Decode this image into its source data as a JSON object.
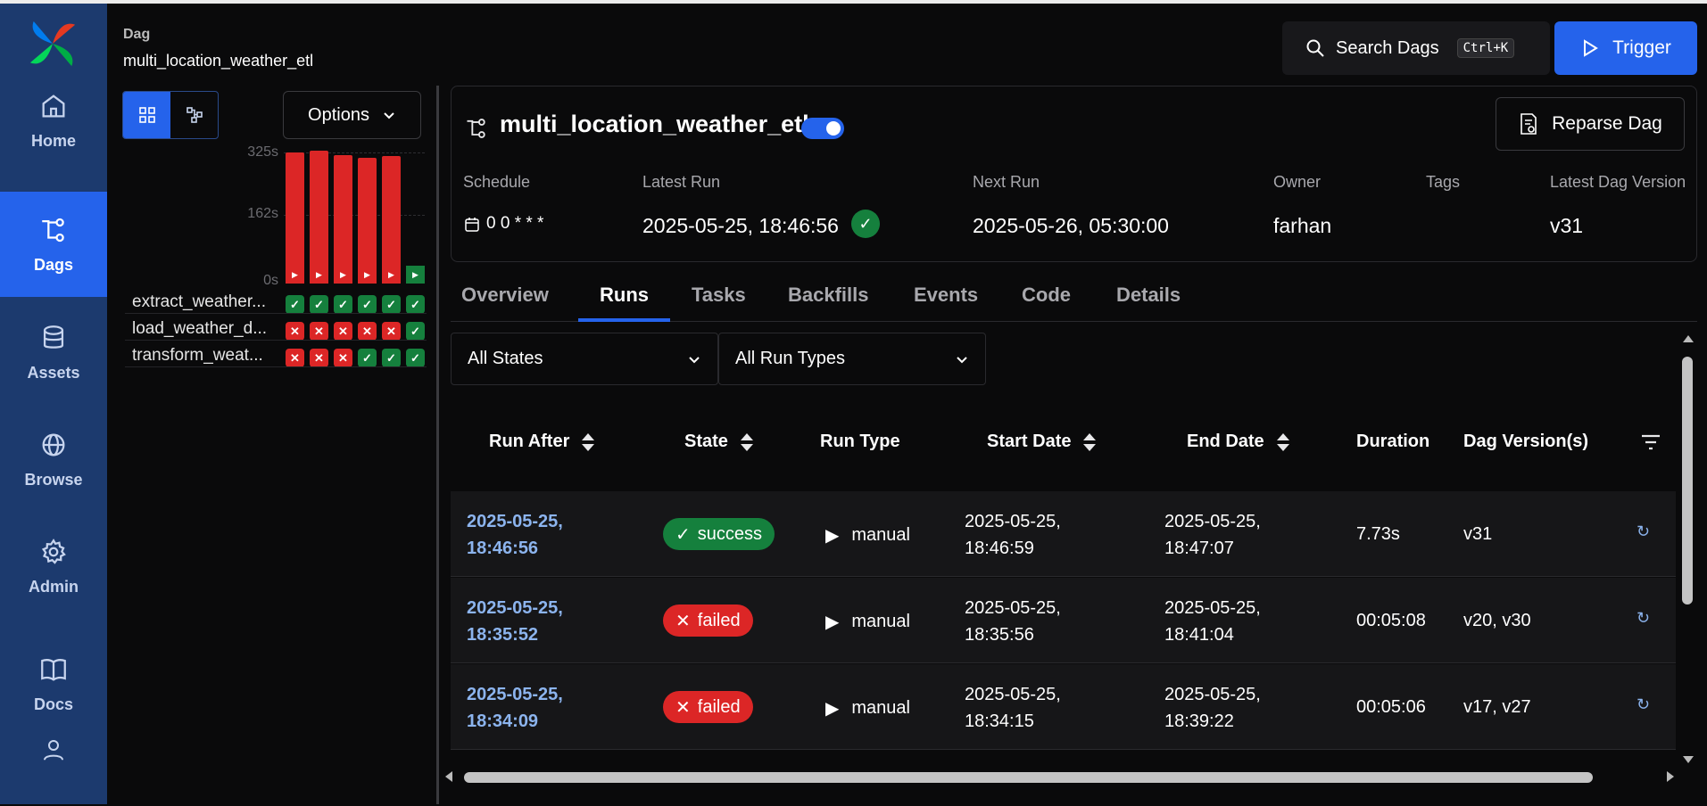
{
  "sidebar": {
    "items": [
      {
        "label": "Home",
        "icon": "home-icon"
      },
      {
        "label": "Dags",
        "icon": "dags-icon",
        "active": true
      },
      {
        "label": "Assets",
        "icon": "database-icon"
      },
      {
        "label": "Browse",
        "icon": "globe-icon"
      },
      {
        "label": "Admin",
        "icon": "gear-icon"
      },
      {
        "label": "Docs",
        "icon": "book-icon"
      },
      {
        "label": "",
        "icon": "user-icon"
      }
    ]
  },
  "breadcrumb": {
    "key": "Dag",
    "value": "multi_location_weather_etl"
  },
  "grid": {
    "options_label": "Options",
    "y_labels": [
      "325s",
      "162s",
      "0s"
    ],
    "run_bar_fraction": [
      0.98,
      0.99,
      0.96,
      0.94,
      0.95,
      0.07
    ],
    "run_bar_state": [
      "failed",
      "failed",
      "failed",
      "failed",
      "failed",
      "success"
    ],
    "tasks": [
      {
        "name": "extract_weather...",
        "states": [
          "ok",
          "ok",
          "ok",
          "ok",
          "ok",
          "ok"
        ]
      },
      {
        "name": "load_weather_d...",
        "states": [
          "x",
          "x",
          "x",
          "x",
          "x",
          "ok"
        ]
      },
      {
        "name": "transform_weat...",
        "states": [
          "x",
          "x",
          "x",
          "ok",
          "ok",
          "ok"
        ]
      }
    ]
  },
  "header": {
    "search_label": "Search Dags",
    "search_shortcut": "Ctrl+K",
    "trigger_label": "Trigger"
  },
  "dag": {
    "title": "multi_location_weather_etl",
    "paused": false,
    "reparse_label": "Reparse Dag",
    "meta_keys": {
      "schedule": "Schedule",
      "latest_run": "Latest Run",
      "next_run": "Next Run",
      "owner": "Owner",
      "tags": "Tags",
      "version": "Latest Dag Version"
    },
    "meta_values": {
      "schedule": "0 0 * * *",
      "latest_run": "2025-05-25, 18:46:56",
      "next_run": "2025-05-26, 05:30:00",
      "owner": "farhan",
      "tags": "",
      "version": "v31"
    }
  },
  "tabs": [
    "Overview",
    "Runs",
    "Tasks",
    "Backfills",
    "Events",
    "Code",
    "Details"
  ],
  "active_tab": "Runs",
  "filters": {
    "state": "All States",
    "run_type": "All Run Types"
  },
  "table": {
    "columns": [
      "Run After",
      "State",
      "Run Type",
      "Start Date",
      "End Date",
      "Duration",
      "Dag Version(s)"
    ],
    "rows": [
      {
        "run_after_1": "2025-05-25,",
        "run_after_2": "18:46:56",
        "state": "success",
        "run_type": "manual",
        "start_1": "2025-05-25,",
        "start_2": "18:46:59",
        "end_1": "2025-05-25,",
        "end_2": "18:47:07",
        "duration": "7.73s",
        "versions": "v31"
      },
      {
        "run_after_1": "2025-05-25,",
        "run_after_2": "18:35:52",
        "state": "failed",
        "run_type": "manual",
        "start_1": "2025-05-25,",
        "start_2": "18:35:56",
        "end_1": "2025-05-25,",
        "end_2": "18:41:04",
        "duration": "00:05:08",
        "versions": "v20, v30"
      },
      {
        "run_after_1": "2025-05-25,",
        "run_after_2": "18:34:09",
        "state": "failed",
        "run_type": "manual",
        "start_1": "2025-05-25,",
        "start_2": "18:34:15",
        "end_1": "2025-05-25,",
        "end_2": "18:39:22",
        "duration": "00:05:06",
        "versions": "v17, v27"
      }
    ]
  },
  "colors": {
    "accent": "#2563eb",
    "success": "#15803d",
    "failed": "#dc2626",
    "sidebar": "#1c3a6e"
  }
}
